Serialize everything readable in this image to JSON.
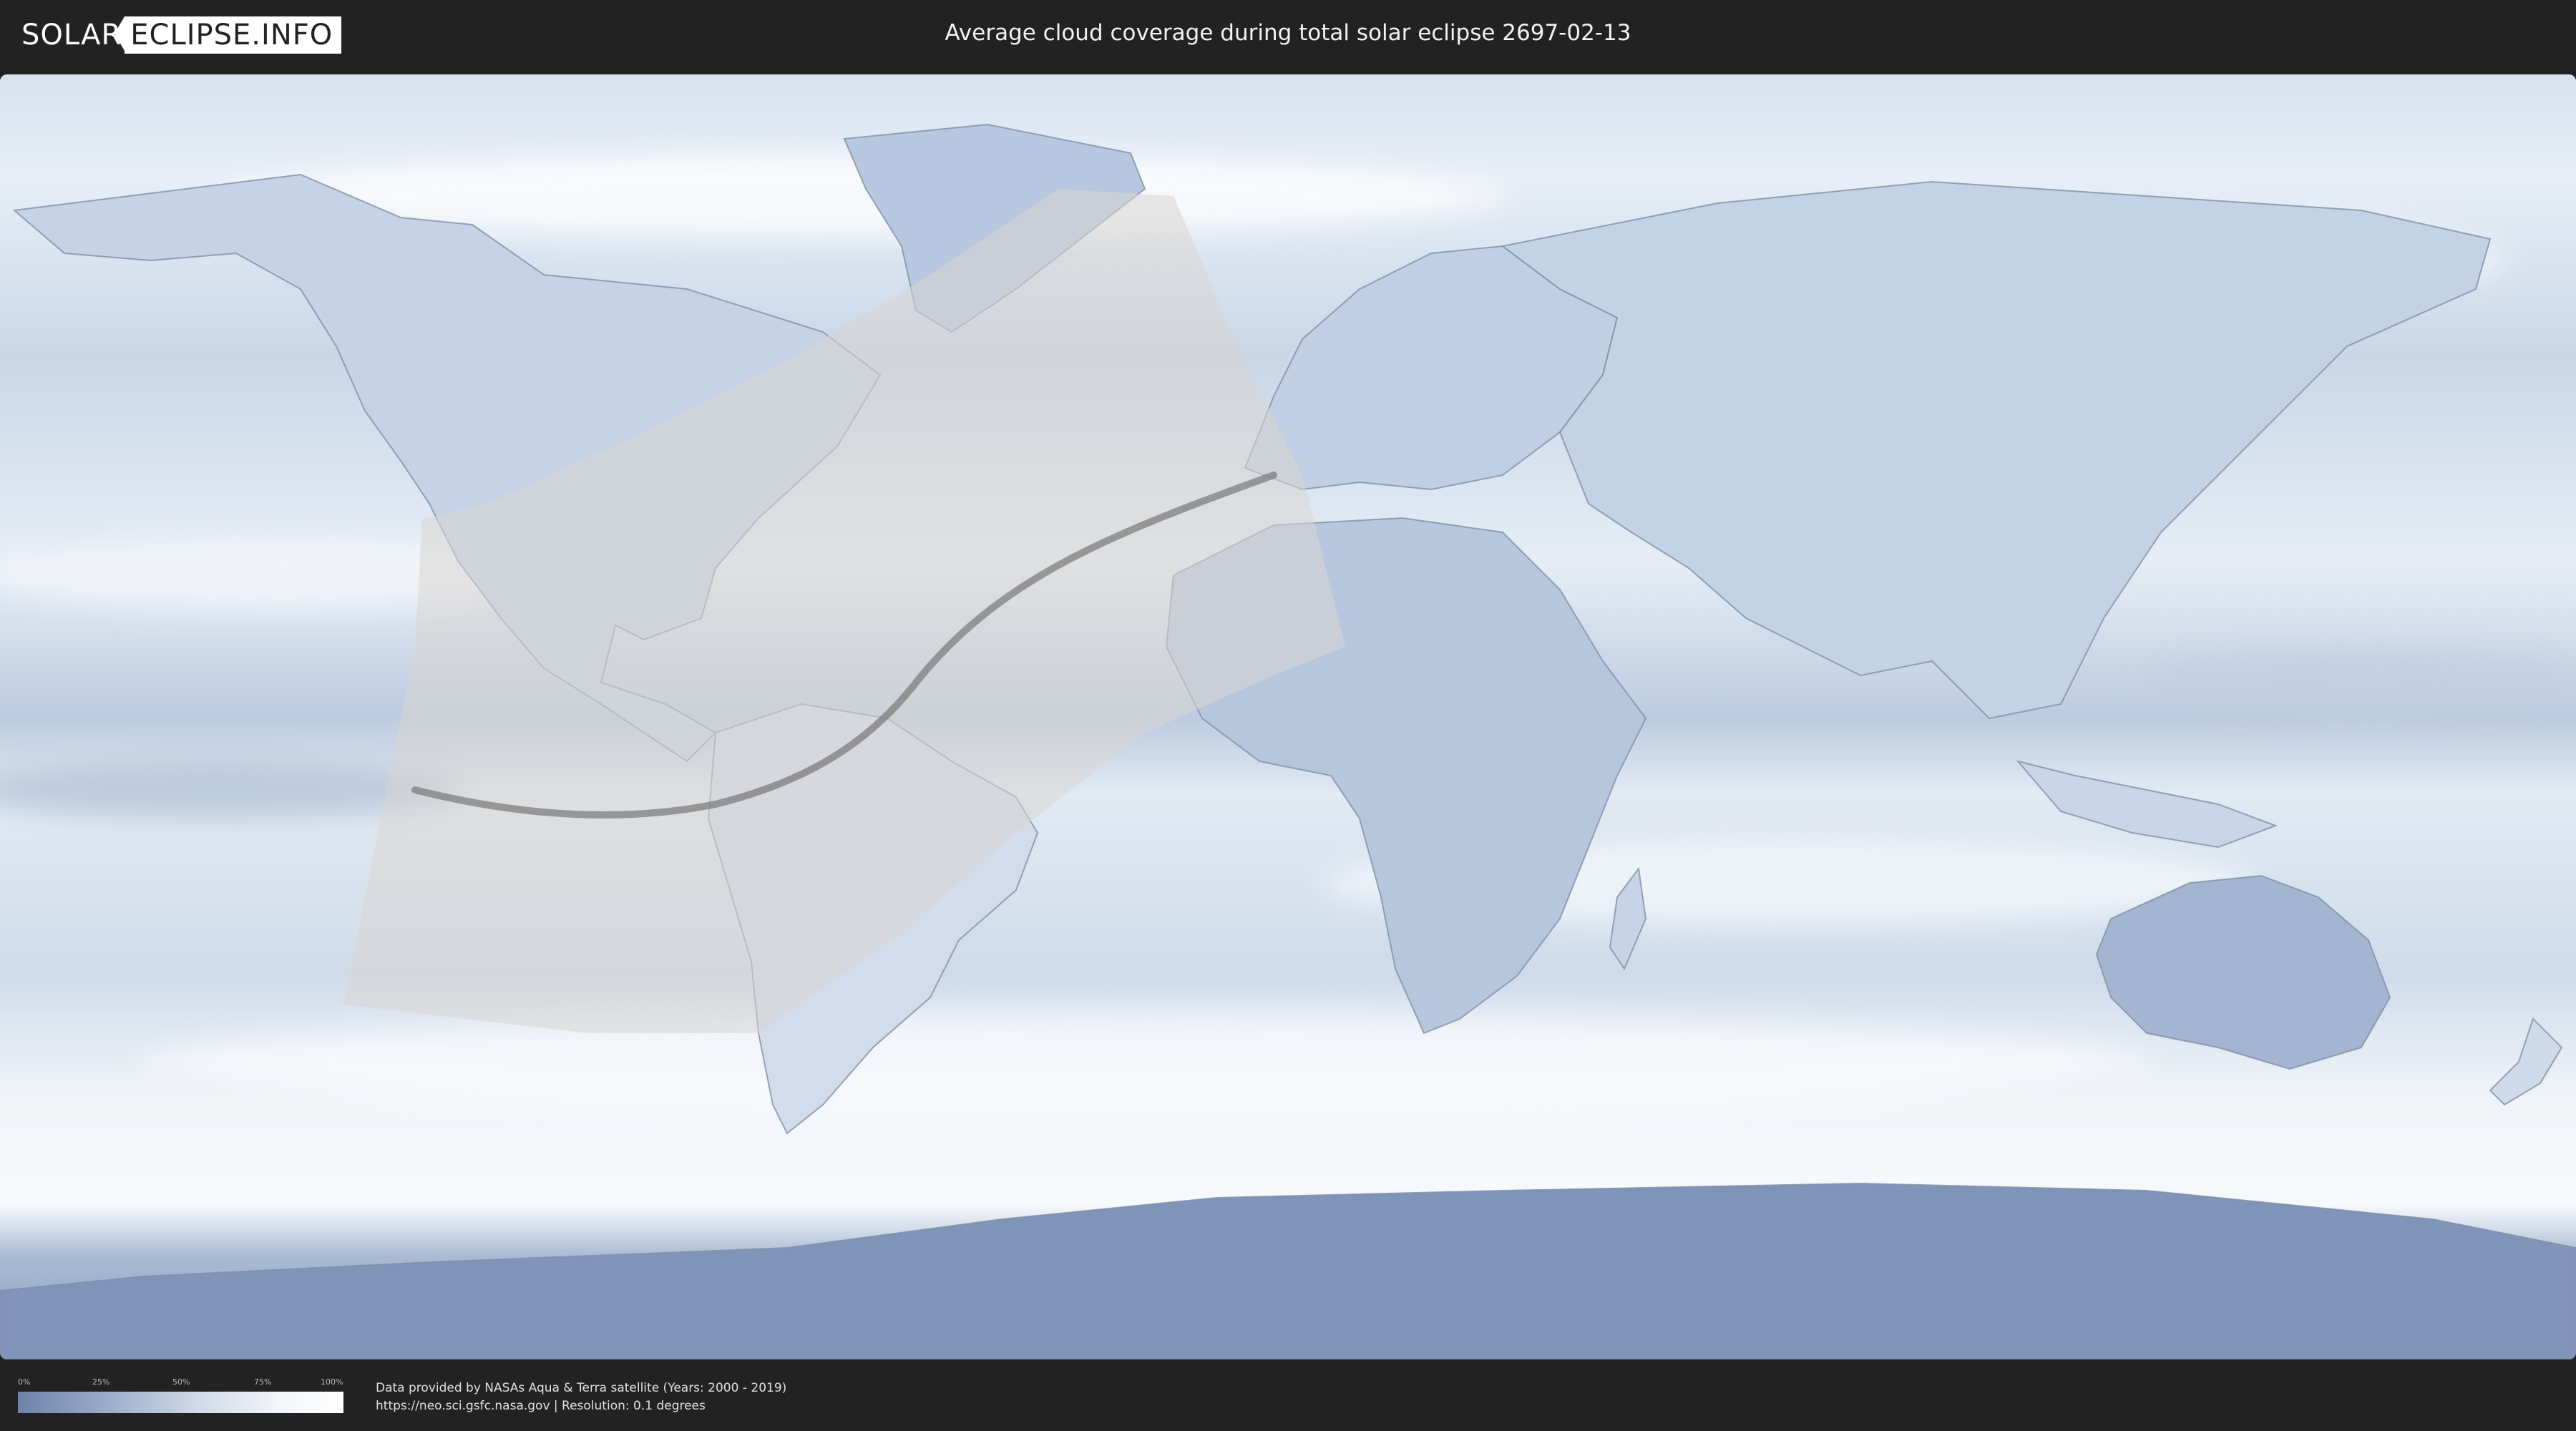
{
  "header": {
    "logo_solar": "SOLAR",
    "logo_eclipse": "ECLIPSE.INFO",
    "title": "Average cloud coverage during total solar eclipse 2697-02-13"
  },
  "map": {
    "projection": "equirectangular",
    "layers": [
      "cloud-coverage",
      "coastlines",
      "country-borders",
      "eclipse-visibility-zone",
      "path-of-totality"
    ],
    "colors": {
      "clear": "#6d83a8",
      "cloudy": "#ffffff",
      "visibility_zone": "#d9d6d2",
      "totality_path": "#777777",
      "background": "#222222"
    }
  },
  "legend": {
    "ticks": [
      "0%",
      "25%",
      "50%",
      "75%",
      "100%"
    ]
  },
  "credits": {
    "line1": "Data provided by NASAs Aqua & Terra satellite (Years: 2000 - 2019)",
    "line2": "https://neo.sci.gsfc.nasa.gov | Resolution: 0.1 degrees"
  }
}
